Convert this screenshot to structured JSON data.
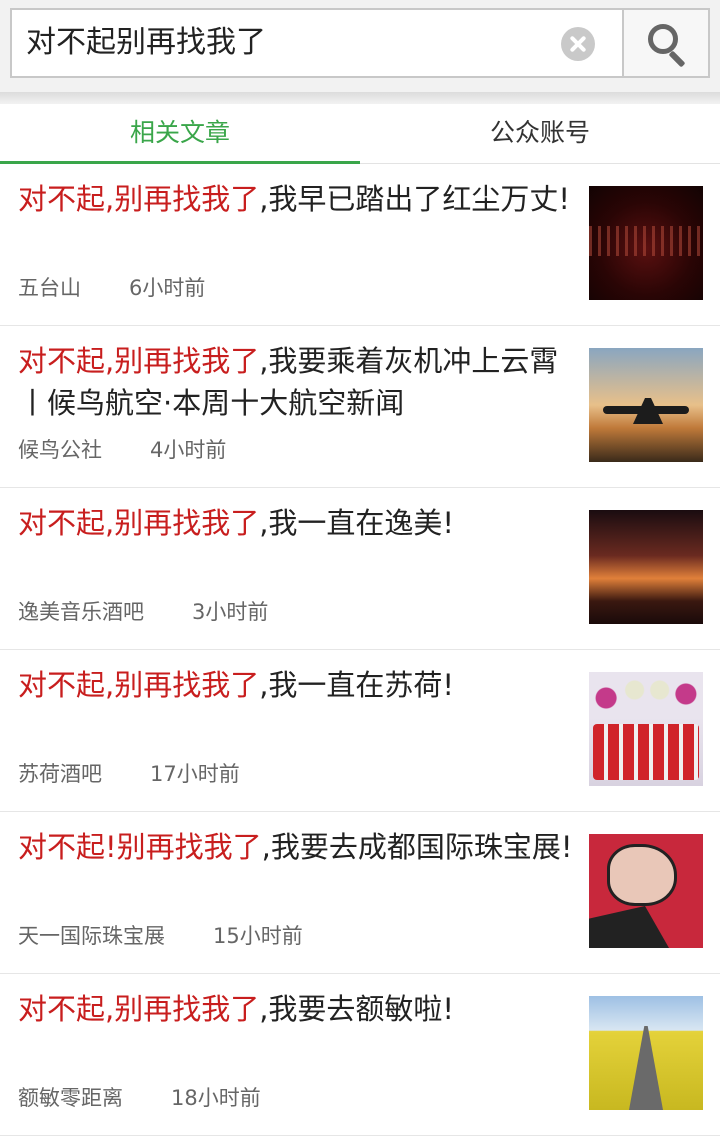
{
  "search": {
    "query": "对不起别再找我了"
  },
  "tabs": [
    {
      "label": "相关文章",
      "active": true
    },
    {
      "label": "公众账号",
      "active": false
    }
  ],
  "colors": {
    "accent_green": "#3aa64a",
    "highlight_red": "#c81e1e"
  },
  "articles": [
    {
      "hl": "对不起,别再找我了",
      "rest": ",我早已踏出了红尘万丈!",
      "source": "五台山",
      "time": "6小时前"
    },
    {
      "hl": "对不起,别再找我了",
      "rest": ",我要乘着灰机冲上云霄丨候鸟航空·本周十大航空新闻",
      "source": "候鸟公社",
      "time": "4小时前"
    },
    {
      "hl": "对不起,别再找我了",
      "rest": ",我一直在逸美!",
      "source": "逸美音乐酒吧",
      "time": "3小时前"
    },
    {
      "hl": "对不起,别再找我了",
      "rest": ",我一直在苏荷!",
      "source": "苏荷酒吧",
      "time": "17小时前"
    },
    {
      "hl": "对不起!别再找我了",
      "rest": ",我要去成都国际珠宝展!",
      "source": "天一国际珠宝展",
      "time": "15小时前"
    },
    {
      "hl": "对不起,别再找我了",
      "rest": ",我要去额敏啦!",
      "source": "额敏零距离",
      "time": "18小时前"
    }
  ]
}
